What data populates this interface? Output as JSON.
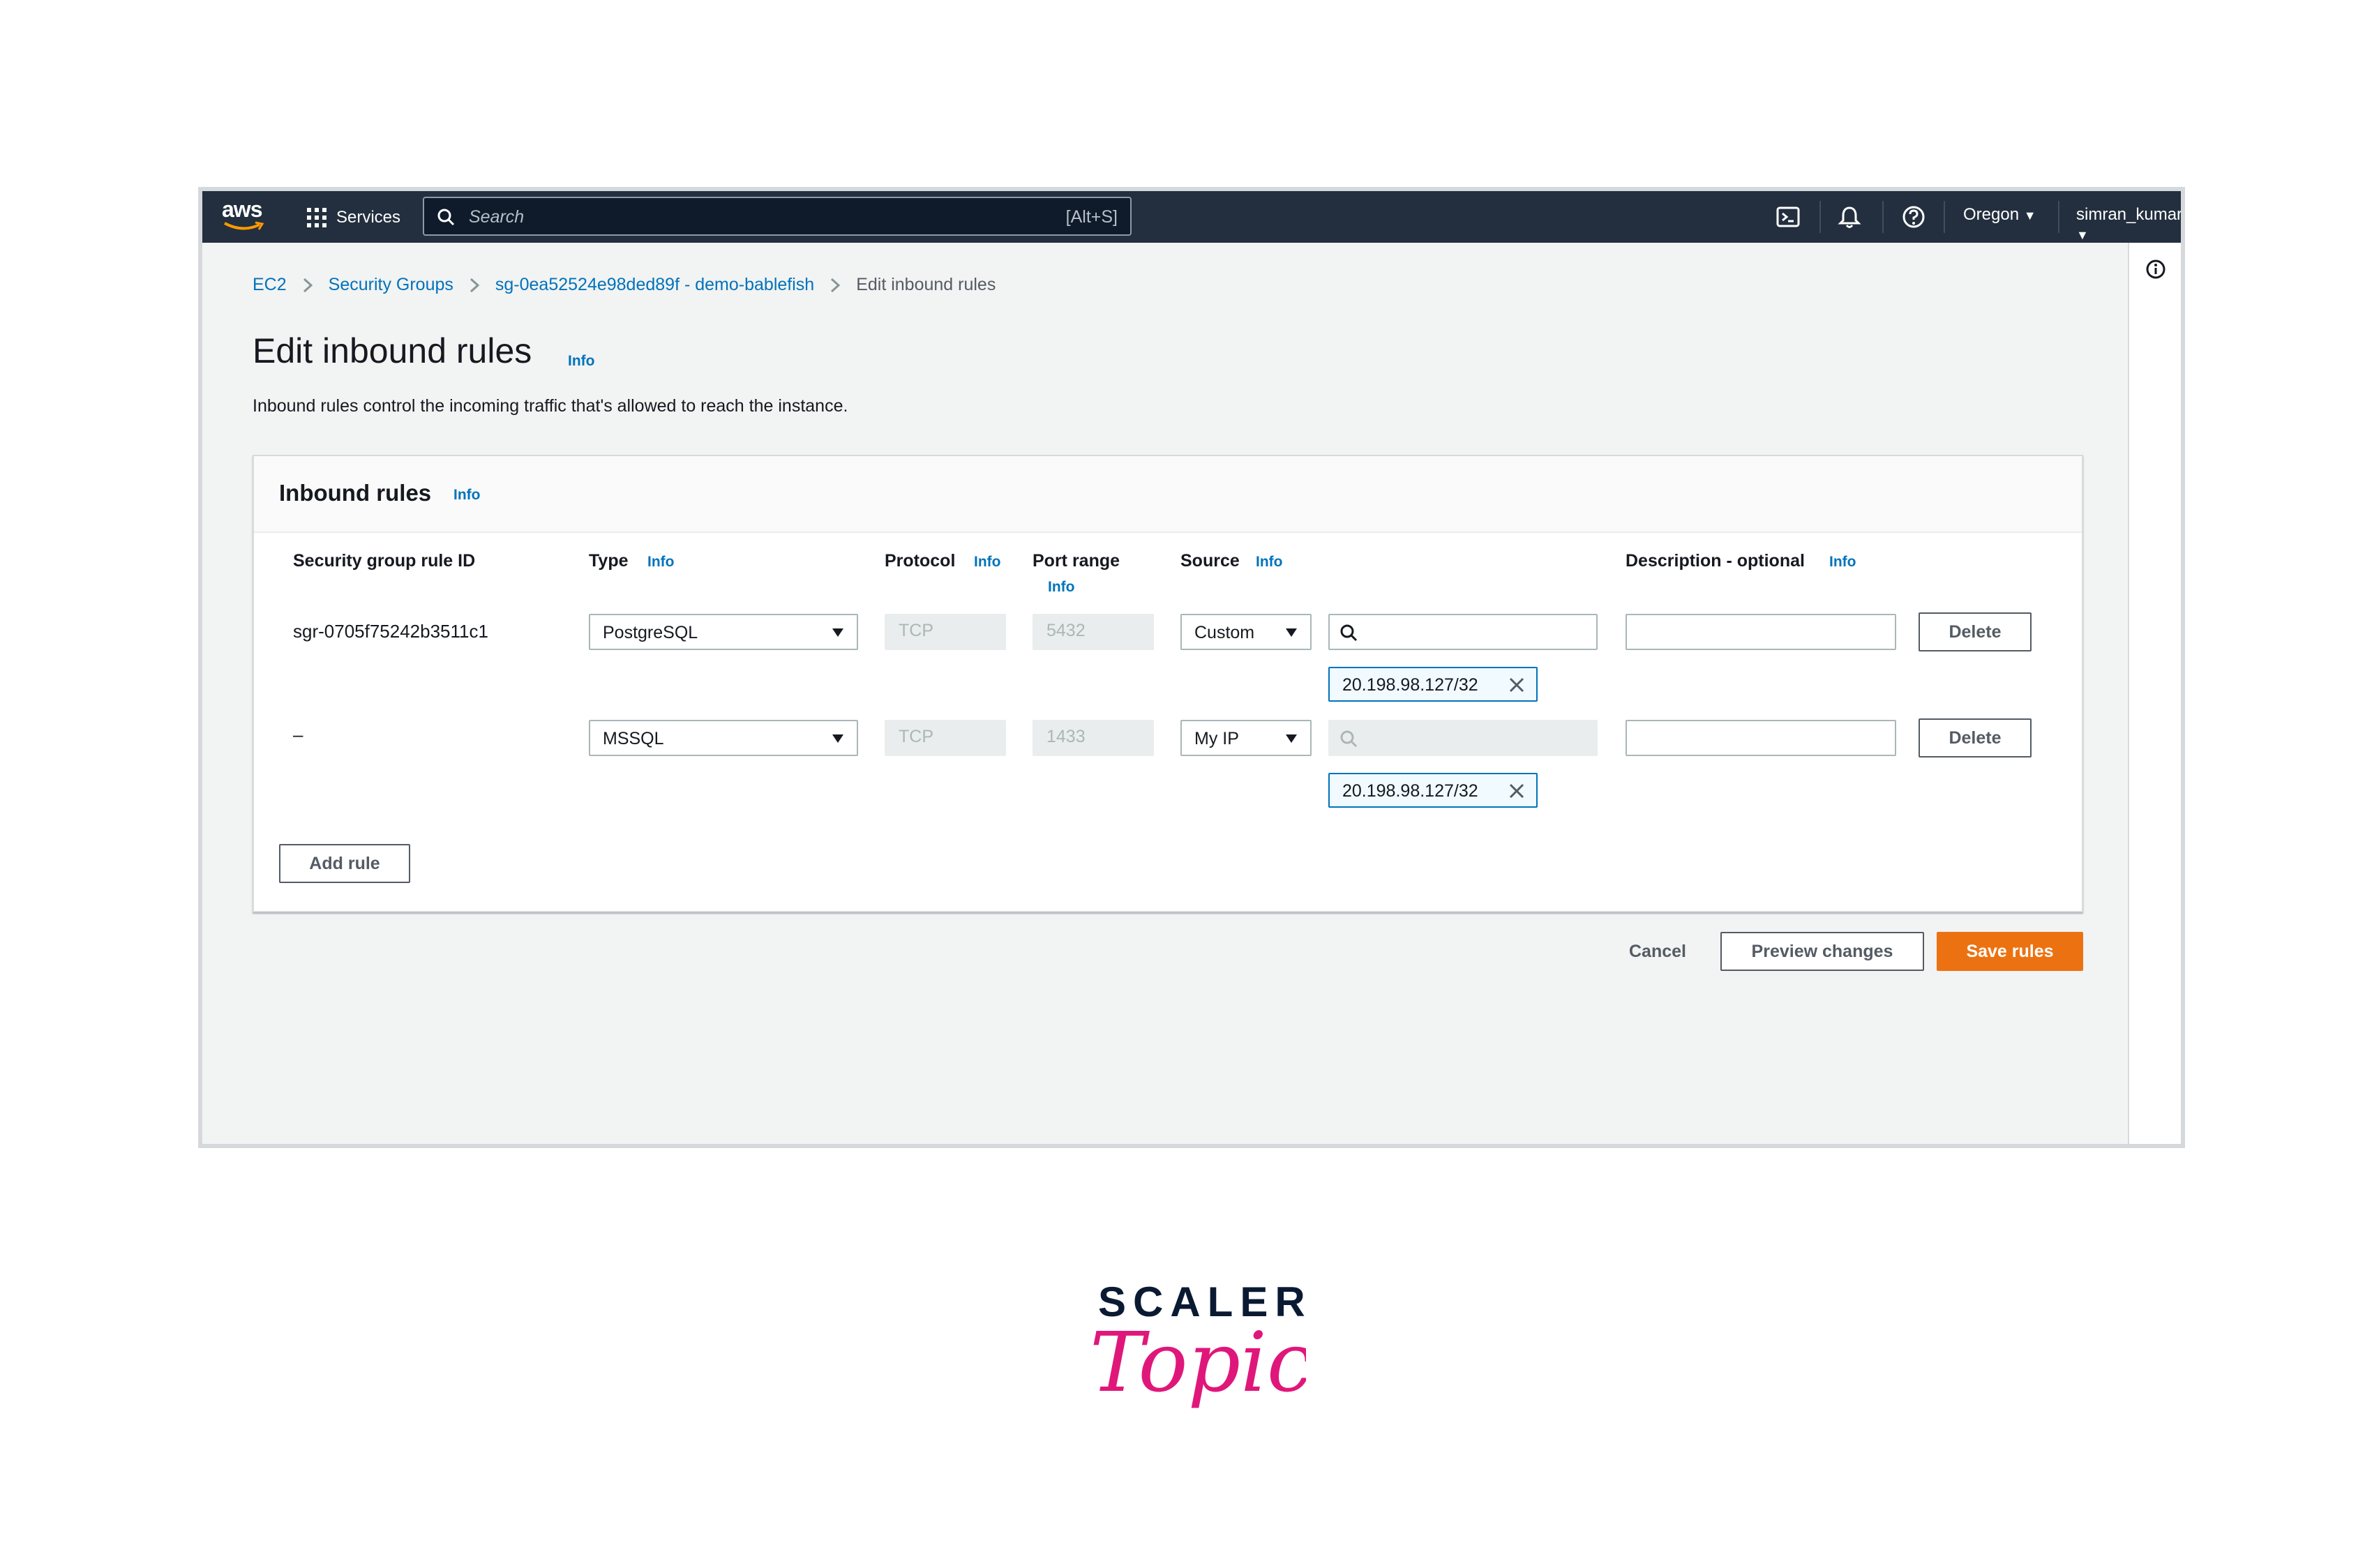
{
  "nav": {
    "logo": "aws",
    "services": "Services",
    "search_placeholder": "Search",
    "search_shortcut": "[Alt+S]",
    "region": "Oregon",
    "user": "simran_kumari",
    "icons": [
      "cloudshell-icon",
      "notifications-icon",
      "help-icon"
    ]
  },
  "breadcrumb": [
    "EC2",
    "Security Groups",
    "sg-0ea52524e98ded89f - demo-bablefish",
    "Edit inbound rules"
  ],
  "page": {
    "title": "Edit inbound rules",
    "info": "Info",
    "subtitle": "Inbound rules control the incoming traffic that's allowed to reach the instance."
  },
  "panel": {
    "title": "Inbound rules",
    "info": "Info",
    "columns": {
      "rule_id": "Security group rule ID",
      "type": "Type",
      "protocol": "Protocol",
      "port_range": "Port range",
      "source": "Source",
      "description": "Description - optional",
      "info": "Info"
    },
    "rows": [
      {
        "rule_id": "sgr-0705f75242b3511c1",
        "type": "PostgreSQL",
        "protocol": "TCP",
        "port": "5432",
        "source_type": "Custom",
        "source_value": "",
        "cidr": "20.198.98.127/32",
        "description": "",
        "delete": "Delete"
      },
      {
        "rule_id": "–",
        "type": "MSSQL",
        "protocol": "TCP",
        "port": "1433",
        "source_type": "My IP",
        "source_value": "",
        "cidr": "20.198.98.127/32",
        "description": "",
        "delete": "Delete"
      }
    ],
    "add_rule": "Add rule"
  },
  "actions": {
    "cancel": "Cancel",
    "preview": "Preview changes",
    "save": "Save rules"
  },
  "brand": {
    "scaler": "SCALER",
    "topics": "Topics",
    "topics_color": "#e0177a"
  },
  "colors": {
    "nav_bg": "#232f3e",
    "link": "#0073bb",
    "primary": "#ec7211"
  }
}
